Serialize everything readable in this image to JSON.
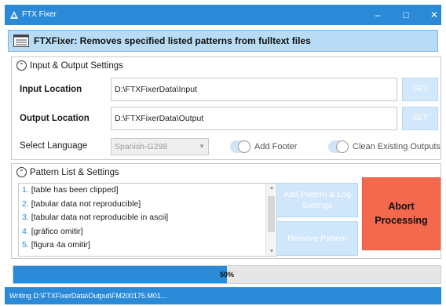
{
  "window": {
    "title": "FTX Fixer"
  },
  "banner": {
    "text": "FTXFixer: Removes specified listed patterns from fulltext files"
  },
  "io": {
    "section_title": "Input & Output Settings",
    "input_label": "Input Location",
    "input_value": "D:\\FTXFixerData\\Input",
    "input_set": "SET",
    "output_label": "Output Location",
    "output_value": "D:\\FTXFixerData\\Output",
    "output_set": "SET",
    "language_label": "Select Language",
    "language_value": "Spanish-G298",
    "add_footer_label": "Add Footer",
    "clean_outputs_label": "Clean Existing Outputs"
  },
  "patterns": {
    "section_title": "Pattern List & Settings",
    "items": [
      {
        "num": "1.",
        "text": "[table has been clipped]"
      },
      {
        "num": "2.",
        "text": "[tabular data not reproducible]"
      },
      {
        "num": "3.",
        "text": "[tabular data not reproducible in ascii]"
      },
      {
        "num": "4.",
        "text": "[gráfico omitir]"
      },
      {
        "num": "5.",
        "text": "[figura 4a omitir]"
      }
    ],
    "add_button": "Add Pattern & Log Settings",
    "remove_button": "Remove Pattern",
    "abort_button": "Abort Processing"
  },
  "progress": {
    "label": "50%",
    "value": 0.5
  },
  "status": {
    "text": "Writing D:\\FTXFixerData\\Output\\FM200175.M01..."
  },
  "colors": {
    "accent": "#2b8ad8",
    "abort": "#f2694d",
    "banner": "#b9dcf6"
  }
}
